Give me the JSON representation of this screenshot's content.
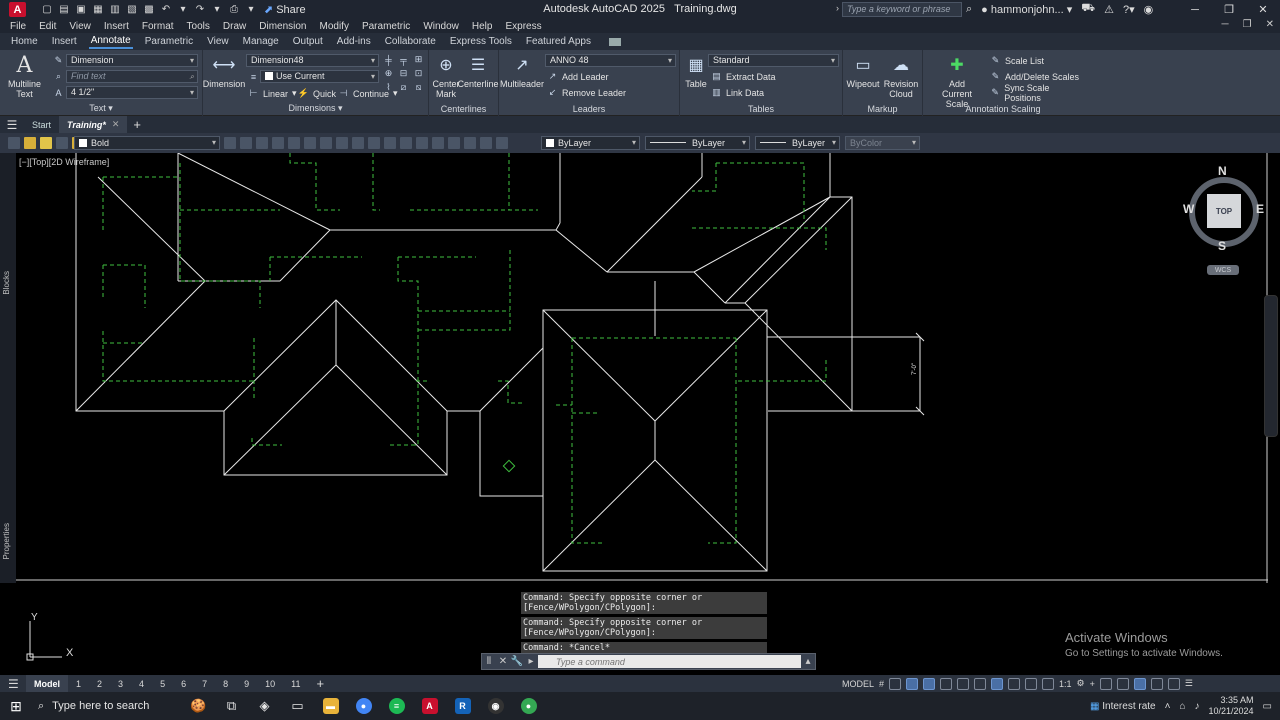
{
  "titlebar": {
    "app_logo": "A",
    "share": "Share",
    "app_name": "Autodesk AutoCAD 2025",
    "file_name": "Training.dwg",
    "search_placeholder": "Type a keyword or phrase",
    "user": "hammonjohn..."
  },
  "menubar": [
    "File",
    "Edit",
    "View",
    "Insert",
    "Format",
    "Tools",
    "Draw",
    "Dimension",
    "Modify",
    "Parametric",
    "Window",
    "Help",
    "Express"
  ],
  "ribbon_tabs": [
    "Home",
    "Insert",
    "Annotate",
    "Parametric",
    "View",
    "Manage",
    "Output",
    "Add-ins",
    "Collaborate",
    "Express Tools",
    "Featured Apps"
  ],
  "ribbon": {
    "text_panel": {
      "title": "Text",
      "multiline": "Multiline",
      "multiline2": "Text",
      "style": "Dimension",
      "find": "Find text",
      "height": "4 1/2\""
    },
    "dim_panel": {
      "title": "Dimensions",
      "dimension": "Dimension",
      "style": "Dimension48",
      "layer": "Use Current",
      "linear": "Linear",
      "quick": "Quick",
      "continue": "Continue"
    },
    "center_panel": {
      "title": "Centerlines",
      "mark": "Center",
      "mark2": "Mark",
      "line": "Centerline"
    },
    "leader_panel": {
      "title": "Leaders",
      "multileader": "Multileader",
      "style": "ANNO 48",
      "add": "Add Leader",
      "remove": "Remove Leader"
    },
    "table_panel": {
      "title": "Tables",
      "table": "Table",
      "style": "Standard",
      "extract": "Extract Data",
      "link": "Link Data"
    },
    "markup_panel": {
      "title": "Markup",
      "wipeout": "Wipeout",
      "revision": "Revision",
      "revision2": "Cloud"
    },
    "scale_panel": {
      "title": "Annotation Scaling",
      "add": "Add",
      "add2": "Current Scale",
      "list": "Scale List",
      "adddelete": "Add/Delete Scales",
      "sync": "Sync Scale Positions"
    }
  },
  "file_tabs": {
    "start": "Start",
    "active": "Training*"
  },
  "layer_bar": {
    "layer": "Bold",
    "color": "ByLayer",
    "linetype": "ByLayer",
    "lineweight": "ByLayer",
    "plotstyle": "ByColor"
  },
  "drawing": {
    "viewport_label": "[−][Top][2D Wireframe]",
    "side_blocks": "Blocks",
    "side_properties": "Properties",
    "viewcube": {
      "n": "N",
      "s": "S",
      "e": "E",
      "w": "W",
      "top": "TOP",
      "wcs": "WCS"
    },
    "dim_text": "7'-0\"",
    "ucs_x": "X",
    "ucs_y": "Y"
  },
  "commands": [
    "Command: Specify opposite corner or [Fence/WPolygon/CPolygon]:",
    "Command: Specify opposite corner or [Fence/WPolygon/CPolygon]:",
    "Command: *Cancel*"
  ],
  "command_placeholder": "Type a command",
  "activate": {
    "title": "Activate Windows",
    "subtitle": "Go to Settings to activate Windows."
  },
  "layout_tabs": [
    "Model",
    "1",
    "2",
    "3",
    "4",
    "5",
    "6",
    "7",
    "8",
    "9",
    "10",
    "11"
  ],
  "status": {
    "model": "MODEL",
    "scale": "1:1"
  },
  "taskbar": {
    "search": "Type here to search",
    "weather": "Interest rate",
    "time": "3:35 AM",
    "date": "10/21/2024"
  }
}
